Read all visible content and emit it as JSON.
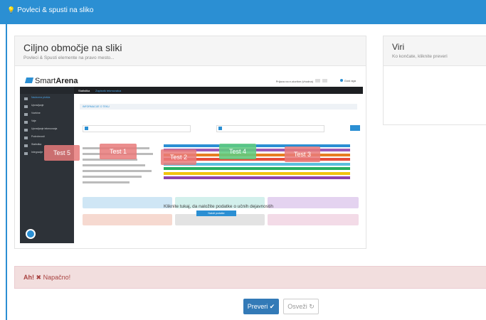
{
  "header": {
    "title": "Povleci & spusti na sliko"
  },
  "target_panel": {
    "title": "Ciljno območje na sliki",
    "subtitle": "Povleci & Spusti elemente na pravo mesto..."
  },
  "sources_panel": {
    "title": "Viri",
    "subtitle": "Ko končate, kliknite preveri"
  },
  "image": {
    "logo_light": "Smart",
    "logo_bold": "Arena",
    "top_link": "Prijava na e-storitve (vhodna)",
    "user": "Gost aga",
    "tab_active": "Statistika",
    "tab_other": "Zapisnik tekmovalca",
    "section_title": "INFORMACIJE O TEKU",
    "message": "Kliknite tukaj, da naložite podatke o učnih dejavnostih",
    "load_button": "Naloži podatke",
    "sidebar_items": [
      "Nadzorna plošča",
      "Upravljanje",
      "Vsebine",
      "Vaje",
      "Upravljanje tekmovanja",
      "Podrobnosti",
      "Statistika",
      "Integracije"
    ]
  },
  "chips": [
    {
      "label": "Test 5",
      "color": "red"
    },
    {
      "label": "Test 1",
      "color": "red"
    },
    {
      "label": "Test 2",
      "color": "red"
    },
    {
      "label": "Test 4",
      "color": "green"
    },
    {
      "label": "Test 3",
      "color": "red"
    }
  ],
  "colors": {
    "accent": "#2b8fd3",
    "bars": [
      "#2b8fd3",
      "#9b59b6",
      "#e67e22",
      "#e74c3c",
      "#5bc0de",
      "#27ae60",
      "#f1c40f",
      "#8e44ad"
    ]
  },
  "alert": {
    "prefix": "Ah!",
    "icon": "x-icon",
    "text": "Napačno!"
  },
  "buttons": {
    "check": "Preveri",
    "refresh": "Osveži"
  }
}
